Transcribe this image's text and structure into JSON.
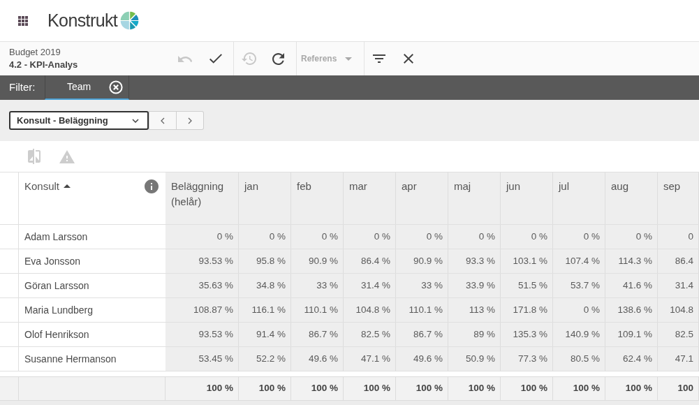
{
  "header": {
    "logo_text": "Konstrukt"
  },
  "toolbar": {
    "subtitle": "Budget 2019",
    "title": "4.2 - KPI-Analys",
    "groups": [
      {
        "items": [
          {
            "kind": "undo",
            "disabled": true
          },
          {
            "kind": "check",
            "disabled": false
          }
        ]
      },
      {
        "items": [
          {
            "kind": "history",
            "disabled": true
          },
          {
            "kind": "refresh",
            "disabled": false
          }
        ]
      },
      {
        "items": [
          {
            "kind": "dropdown",
            "label": "Referens",
            "disabled": true
          }
        ]
      },
      {
        "items": [
          {
            "kind": "filter",
            "disabled": false
          },
          {
            "kind": "close",
            "disabled": false
          }
        ]
      }
    ]
  },
  "filter_bar": {
    "label": "Filter:",
    "chips": [
      {
        "label": "Team",
        "selected": true
      }
    ]
  },
  "view_selector": {
    "value": "Konsult - Beläggning"
  },
  "actions": [
    {
      "kind": "compare",
      "disabled": true
    },
    {
      "kind": "warning",
      "disabled": true
    }
  ],
  "table": {
    "columns": [
      {
        "kind": "name",
        "label": "Konsult",
        "sort_ascending": true
      },
      {
        "kind": "value",
        "label": "Beläggning (helår)"
      },
      {
        "kind": "value",
        "label": "jan"
      },
      {
        "kind": "value",
        "label": "feb"
      },
      {
        "kind": "value",
        "label": "mar"
      },
      {
        "kind": "value",
        "label": "apr"
      },
      {
        "kind": "value",
        "label": "maj"
      },
      {
        "kind": "value",
        "label": "jun"
      },
      {
        "kind": "value",
        "label": "jul"
      },
      {
        "kind": "value",
        "label": "aug"
      },
      {
        "kind": "value",
        "label": "sep"
      }
    ],
    "rows": [
      {
        "name": "Adam Larsson",
        "values": [
          "0 %",
          "0 %",
          "0 %",
          "0 %",
          "0 %",
          "0 %",
          "0 %",
          "0 %",
          "0 %",
          "0"
        ]
      },
      {
        "name": "Eva Jonsson",
        "values": [
          "93.53 %",
          "95.8 %",
          "90.9 %",
          "86.4 %",
          "90.9 %",
          "93.3 %",
          "103.1 %",
          "107.4 %",
          "114.3 %",
          "86.4"
        ]
      },
      {
        "name": "Göran Larsson",
        "values": [
          "35.63 %",
          "34.8 %",
          "33 %",
          "31.4 %",
          "33 %",
          "33.9 %",
          "51.5 %",
          "53.7 %",
          "41.6 %",
          "31.4"
        ]
      },
      {
        "name": "Maria Lundberg",
        "values": [
          "108.87 %",
          "116.1 %",
          "110.1 %",
          "104.8 %",
          "110.1 %",
          "113 %",
          "171.8 %",
          "0 %",
          "138.6 %",
          "104.8"
        ]
      },
      {
        "name": "Olof Henrikson",
        "values": [
          "93.53 %",
          "91.4 %",
          "86.7 %",
          "82.5 %",
          "86.7 %",
          "89 %",
          "135.3 %",
          "140.9 %",
          "109.1 %",
          "82.5"
        ]
      },
      {
        "name": "Susanne Hermanson",
        "values": [
          "53.45 %",
          "52.2 %",
          "49.6 %",
          "47.1 %",
          "49.6 %",
          "50.9 %",
          "77.3 %",
          "80.5 %",
          "62.4 %",
          "47.1"
        ]
      }
    ],
    "totals": [
      "100 %",
      "100 %",
      "100 %",
      "100 %",
      "100 %",
      "100 %",
      "100 %",
      "100 %",
      "100 %",
      "100"
    ]
  }
}
